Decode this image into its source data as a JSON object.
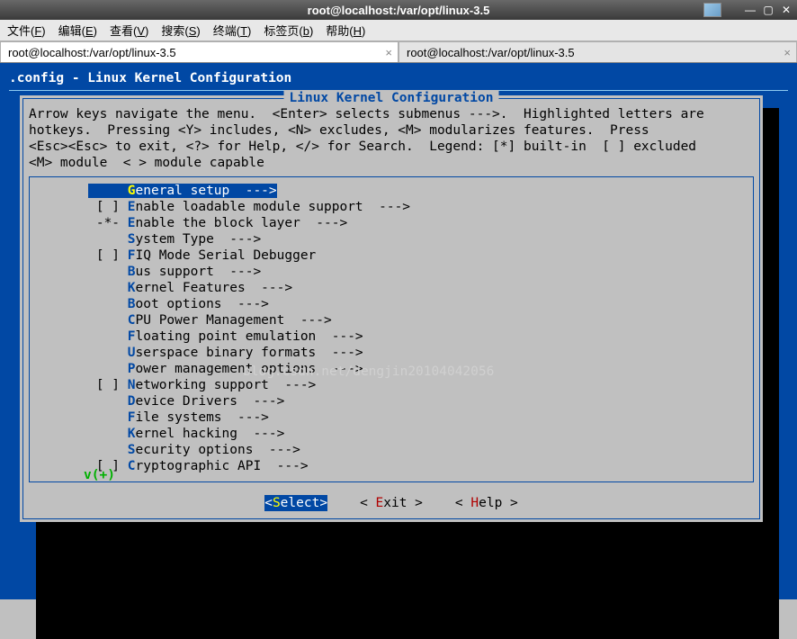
{
  "window": {
    "title": "root@localhost:/var/opt/linux-3.5"
  },
  "menubar": [
    {
      "label": "文件",
      "hotkey": "F"
    },
    {
      "label": "编辑",
      "hotkey": "E"
    },
    {
      "label": "查看",
      "hotkey": "V"
    },
    {
      "label": "搜索",
      "hotkey": "S"
    },
    {
      "label": "终端",
      "hotkey": "T"
    },
    {
      "label": "标签页",
      "hotkey": "b"
    },
    {
      "label": "帮助",
      "hotkey": "H"
    }
  ],
  "tabs": [
    {
      "label": "root@localhost:/var/opt/linux-3.5",
      "active": true
    },
    {
      "label": "root@localhost:/var/opt/linux-3.5",
      "active": false
    }
  ],
  "config": {
    "header": ".config - Linux Kernel Configuration",
    "frame_title": "Linux Kernel Configuration",
    "instructions": [
      "Arrow keys navigate the menu.  <Enter> selects submenus --->.  Highlighted letters are",
      "hotkeys.  Pressing <Y> includes, <N> excludes, <M> modularizes features.  Press",
      "<Esc><Esc> to exit, <?> for Help, </> for Search.  Legend: [*] built-in  [ ] excluded",
      "<M> module  < > module capable"
    ],
    "watermark": "blog.csdn.net/dengjin20104042056",
    "items": [
      {
        "mark": "   ",
        "hotkey": "G",
        "text": "eneral setup  --->",
        "selected": true
      },
      {
        "mark": "[ ]",
        "hotkey": "E",
        "text": "nable loadable module support  --->"
      },
      {
        "mark": "-*-",
        "hotkey": "E",
        "text": "nable the block layer  --->"
      },
      {
        "mark": "   ",
        "hotkey": "S",
        "text": "ystem Type  --->"
      },
      {
        "mark": "[ ]",
        "hotkey": "F",
        "text": "IQ Mode Serial Debugger"
      },
      {
        "mark": "   ",
        "hotkey": "B",
        "text": "us support  --->"
      },
      {
        "mark": "   ",
        "hotkey": "K",
        "text": "ernel Features  --->"
      },
      {
        "mark": "   ",
        "hotkey": "B",
        "text": "oot options  --->"
      },
      {
        "mark": "   ",
        "hotkey": "C",
        "text": "PU Power Management  --->"
      },
      {
        "mark": "   ",
        "hotkey": "F",
        "text": "loating point emulation  --->"
      },
      {
        "mark": "   ",
        "hotkey": "U",
        "text": "serspace binary formats  --->"
      },
      {
        "mark": "   ",
        "hotkey": "P",
        "text": "ower management options  --->"
      },
      {
        "mark": "[ ]",
        "hotkey": "N",
        "text": "etworking support  --->"
      },
      {
        "mark": "   ",
        "hotkey": "D",
        "text": "evice Drivers  --->"
      },
      {
        "mark": "   ",
        "hotkey": "F",
        "text": "ile systems  --->"
      },
      {
        "mark": "   ",
        "hotkey": "K",
        "text": "ernel hacking  --->"
      },
      {
        "mark": "   ",
        "hotkey": "S",
        "text": "ecurity options  --->"
      },
      {
        "mark": "[ ]",
        "hotkey": "C",
        "text": "ryptographic API  --->"
      }
    ],
    "more_indicator": "v(+)",
    "buttons": [
      {
        "text": "Select",
        "hotkey": "S",
        "selected": true
      },
      {
        "text": "xit",
        "hotkey": "E",
        "prefix": "< ",
        "suffix": " >"
      },
      {
        "text": "elp",
        "hotkey": "H",
        "prefix": "< ",
        "suffix": " >"
      }
    ]
  }
}
